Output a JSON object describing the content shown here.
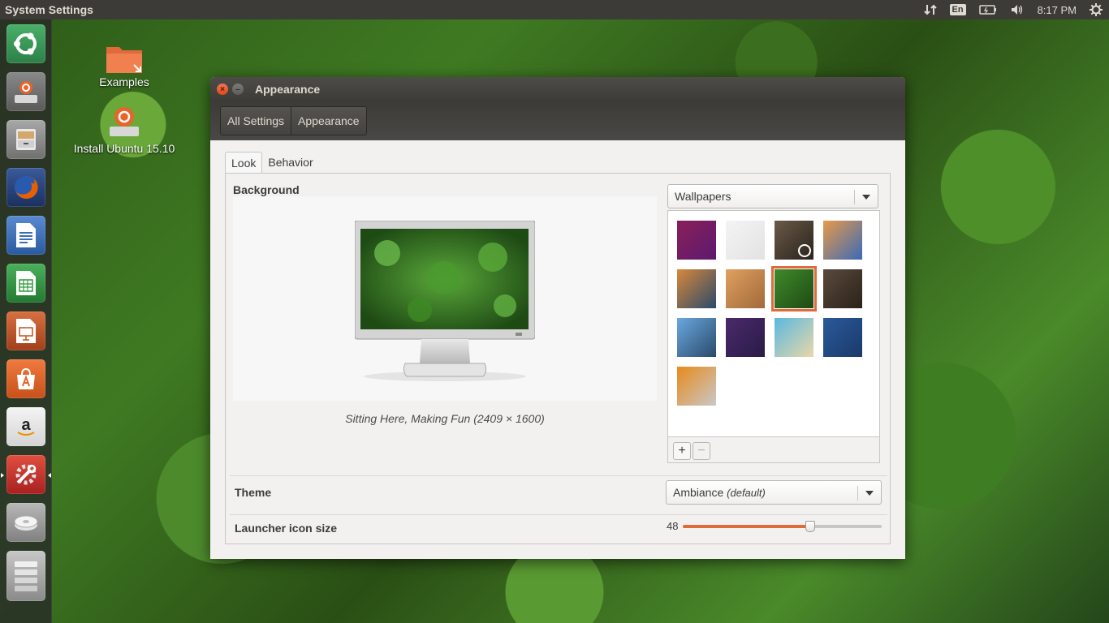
{
  "top_panel": {
    "app_title": "System Settings",
    "indicators": {
      "network_icon": "transfer-arrows-icon",
      "language": "En",
      "battery_icon": "battery-icon",
      "volume_icon": "speaker-icon",
      "clock": "8:17 PM",
      "session_icon": "gear-icon"
    }
  },
  "launcher": {
    "items": [
      {
        "name": "dash-home",
        "icon": "ubuntu-logo-icon",
        "color": "#3a9a58"
      },
      {
        "name": "install-ubuntu",
        "icon": "installer-icon",
        "color": "#707070"
      },
      {
        "name": "files",
        "icon": "file-cabinet-icon",
        "color": "#8a8a8a"
      },
      {
        "name": "firefox",
        "icon": "firefox-icon",
        "color": "#e66000"
      },
      {
        "name": "libreoffice-writer",
        "icon": "writer-icon",
        "color": "#3a6fb8"
      },
      {
        "name": "libreoffice-calc",
        "icon": "calc-icon",
        "color": "#2e9a3c"
      },
      {
        "name": "libreoffice-impress",
        "icon": "impress-icon",
        "color": "#c4541c"
      },
      {
        "name": "ubuntu-software-center",
        "icon": "software-center-icon",
        "color": "#e8642a"
      },
      {
        "name": "amazon",
        "icon": "amazon-icon",
        "color": "#2a2a2a"
      },
      {
        "name": "system-settings",
        "icon": "settings-wrench-icon",
        "color": "#c9302c"
      },
      {
        "name": "drive",
        "icon": "drive-icon",
        "color": "#9a9a9a"
      },
      {
        "name": "workspace-switcher",
        "icon": "workspace-icon",
        "color": "#b0b0b0"
      }
    ]
  },
  "desktop": {
    "icons": [
      {
        "label": "Examples",
        "icon": "folder-icon"
      },
      {
        "label": "Install Ubuntu 15.10",
        "icon": "installer-icon"
      }
    ]
  },
  "window": {
    "title": "Appearance",
    "breadcrumbs": [
      "All Settings",
      "Appearance"
    ],
    "tabs": [
      "Look",
      "Behavior"
    ],
    "background_label": "Background",
    "wallpaper_caption": "Sitting Here, Making Fun (2409 × 1600)",
    "wallpaper_source": "Wallpapers",
    "add_button": "+",
    "remove_button": "−",
    "theme_label": "Theme",
    "theme_value": "Ambiance",
    "theme_default_tag": "(default)",
    "launcher_size_label": "Launcher icon size",
    "launcher_size_value": "48",
    "launcher_size_fraction": 0.64
  },
  "wallpapers": [
    {
      "name": "purple-gradient",
      "colors": [
        "#8a1f5a",
        "#5c1a6e"
      ],
      "selected": false
    },
    {
      "name": "light-gray",
      "colors": [
        "#f4f4f4",
        "#e2e2e2"
      ],
      "selected": false
    },
    {
      "name": "dark-clock",
      "colors": [
        "#6a5a48",
        "#2a221c"
      ],
      "selected": false,
      "badge": "clock-icon"
    },
    {
      "name": "pebbles-sunset",
      "colors": [
        "#e89a48",
        "#3a6ab8"
      ],
      "selected": false
    },
    {
      "name": "sea-anemone",
      "colors": [
        "#d8883a",
        "#2a4a6a"
      ],
      "selected": false
    },
    {
      "name": "wheat-field",
      "colors": [
        "#e0a060",
        "#a06a3a"
      ],
      "selected": false
    },
    {
      "name": "clover",
      "colors": [
        "#3f8a2a",
        "#1e4a14"
      ],
      "selected": true
    },
    {
      "name": "dark-brown",
      "colors": [
        "#5a4a3c",
        "#2a221a"
      ],
      "selected": false
    },
    {
      "name": "palm-fronds",
      "colors": [
        "#6aa8e0",
        "#2a4a6a"
      ],
      "selected": false
    },
    {
      "name": "purple-texture",
      "colors": [
        "#4a2a6a",
        "#2a1a48"
      ],
      "selected": false
    },
    {
      "name": "building-sky",
      "colors": [
        "#5ab8e0",
        "#e8d8a8"
      ],
      "selected": false
    },
    {
      "name": "blue-water",
      "colors": [
        "#2a5a9a",
        "#1a3a6a"
      ],
      "selected": false
    },
    {
      "name": "orange-gray-abstract",
      "colors": [
        "#e88a1a",
        "#c8c8c8"
      ],
      "selected": false
    }
  ]
}
